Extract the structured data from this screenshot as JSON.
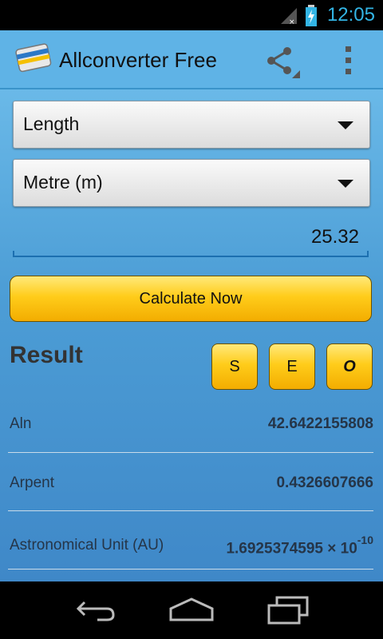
{
  "status": {
    "time": "12:05"
  },
  "app": {
    "title": "Allconverter Free"
  },
  "category": {
    "selected": "Length"
  },
  "unit": {
    "selected": "Metre (m)"
  },
  "input": {
    "value": "25.32"
  },
  "calculate": {
    "label": "Calculate Now"
  },
  "result": {
    "title": "Result",
    "modes": [
      "S",
      "E",
      "O"
    ],
    "rows": [
      {
        "name": "Aln",
        "value": "42.6422155808"
      },
      {
        "name": "Arpent",
        "value": "0.4326607666"
      },
      {
        "name": "Astronomical Unit (AU)",
        "value": "1.6925374595 × 10",
        "exponent": "-10"
      }
    ]
  },
  "colors": {
    "accent": "#33b5e5",
    "actionbar": "#5fb3e6",
    "button": "#ffcc1a"
  }
}
